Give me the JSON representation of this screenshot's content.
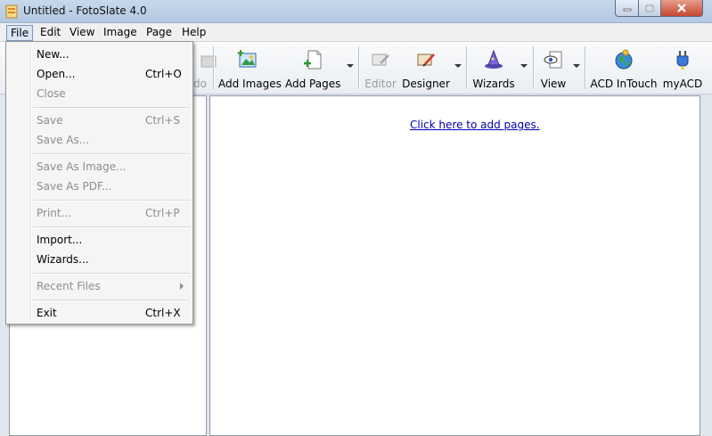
{
  "window": {
    "title": "Untitled - FotoSlate 4.0"
  },
  "menubar": {
    "items": [
      "File",
      "Edit",
      "View",
      "Image",
      "Page",
      "Help"
    ]
  },
  "toolbar": {
    "undo_partial": "do",
    "add_images": "Add Images",
    "add_pages": "Add Pages",
    "editor": "Editor",
    "designer": "Designer",
    "wizards": "Wizards",
    "view": "View",
    "acd_intouch": "ACD InTouch",
    "myacd": "myACD"
  },
  "canvas": {
    "link": "Click here to add pages."
  },
  "file_menu": {
    "new": {
      "label": "New...",
      "shortcut": ""
    },
    "open": {
      "label": "Open...",
      "shortcut": "Ctrl+O"
    },
    "close": {
      "label": "Close",
      "shortcut": ""
    },
    "save": {
      "label": "Save",
      "shortcut": "Ctrl+S"
    },
    "save_as": {
      "label": "Save As...",
      "shortcut": ""
    },
    "save_as_image": {
      "label": "Save As Image...",
      "shortcut": ""
    },
    "save_as_pdf": {
      "label": "Save As PDF...",
      "shortcut": ""
    },
    "print": {
      "label": "Print...",
      "shortcut": "Ctrl+P"
    },
    "import": {
      "label": "Import...",
      "shortcut": ""
    },
    "wizards": {
      "label": "Wizards...",
      "shortcut": ""
    },
    "recent_files": {
      "label": "Recent Files",
      "shortcut": ""
    },
    "exit": {
      "label": "Exit",
      "shortcut": "Ctrl+X"
    }
  },
  "colors": {
    "link": "#0000b0",
    "titlebar": "#b9cee6",
    "close_button": "#c5482f"
  }
}
